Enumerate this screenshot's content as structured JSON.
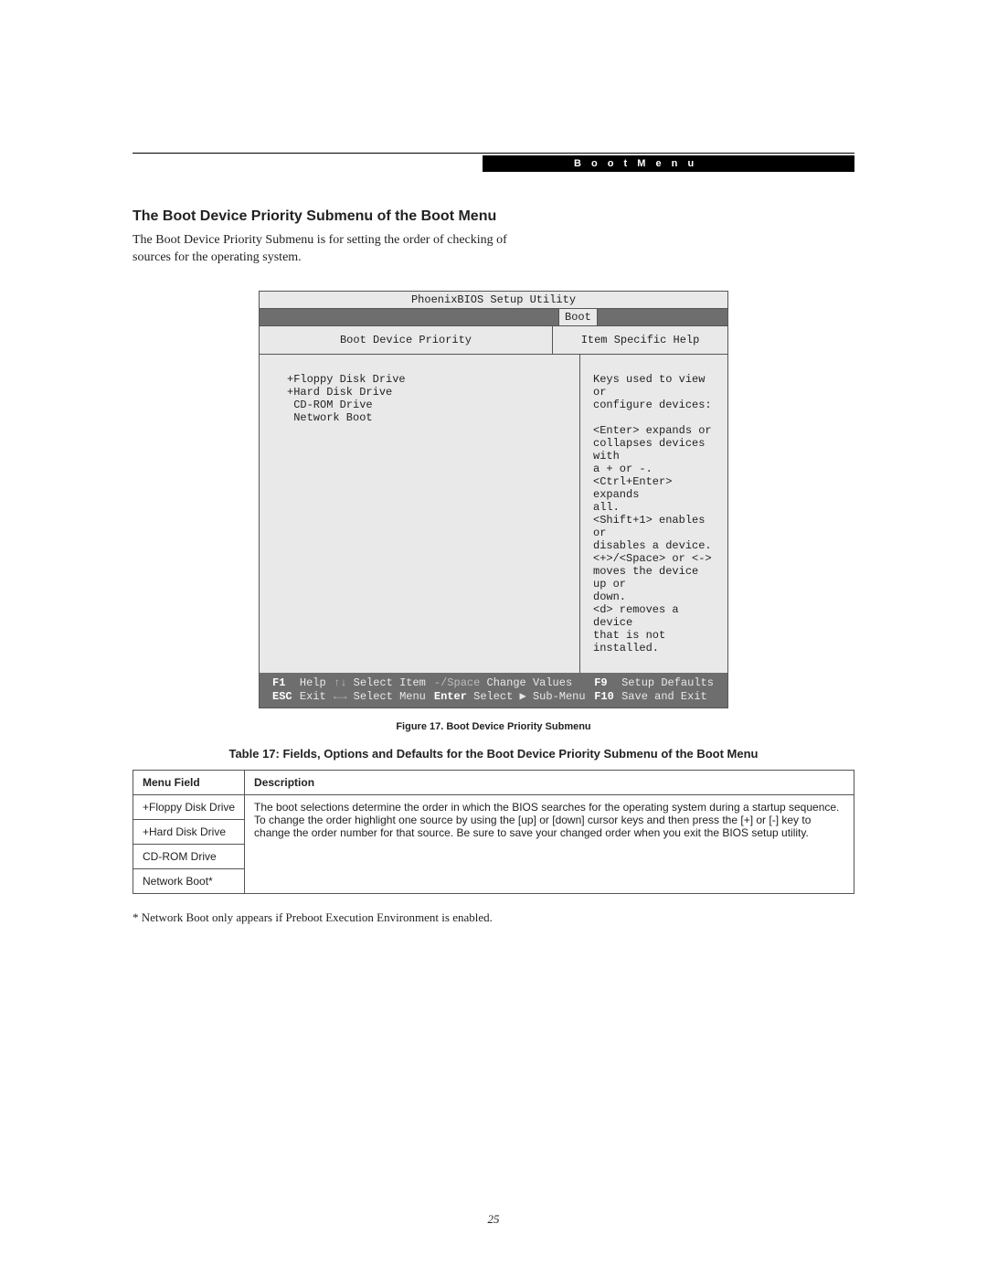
{
  "header": {
    "tab": "B o o t   M e n u"
  },
  "section": {
    "title": "The Boot Device Priority Submenu of the Boot Menu",
    "intro": "The Boot Device Priority Submenu is for setting the order of checking of sources for the operating system."
  },
  "bios": {
    "title": "PhoenixBIOS Setup Utility",
    "tab": "Boot",
    "col_a_header": "Boot Device Priority",
    "col_b_header": "Item Specific Help",
    "devices": "+Floppy Disk Drive\n+Hard Disk Drive\n CD-ROM Drive\n Network Boot",
    "help": "Keys used to view or\nconfigure devices:\n\n<Enter> expands or\ncollapses devices with\na + or -.\n<Ctrl+Enter> expands\nall.\n<Shift+1> enables or\ndisables a device.\n<+>/<Space> or <->\nmoves the device up or\ndown.\n<d> removes a device\nthat is not installed.",
    "footer": {
      "r1": {
        "k1": "F1",
        "a1": "Help",
        "k2": "↑↓",
        "a2": "Select Item",
        "k3": "-/Space",
        "a3": "Change Values",
        "k4": "F9",
        "a4": "Setup Defaults"
      },
      "r2": {
        "k1": "ESC",
        "a1": "Exit",
        "k2": "←→",
        "a2": "Select Menu",
        "k3": "Enter",
        "a3": "Select ▶ Sub-Menu",
        "k4": "F10",
        "a4": "Save and Exit"
      }
    }
  },
  "figure_caption": "Figure 17.  Boot Device Priority Submenu",
  "table": {
    "title": "Table 17: Fields, Options and Defaults for the Boot Device Priority Submenu of the Boot Menu",
    "head": {
      "field": "Menu Field",
      "desc": "Description"
    },
    "rows": [
      "+Floppy Disk Drive",
      "+Hard Disk Drive",
      "CD-ROM Drive",
      "Network Boot*"
    ],
    "desc": "The boot selections determine the order in which the BIOS searches for the operating system during a startup sequence. To change the order highlight one source by using the [up] or [down] cursor keys and then press the [+] or [-] key to change the order number for that source. Be sure to save your changed order when you exit the BIOS setup utility."
  },
  "footnote": "* Network Boot only appears if Preboot Execution Environment is enabled.",
  "page_number": "25"
}
